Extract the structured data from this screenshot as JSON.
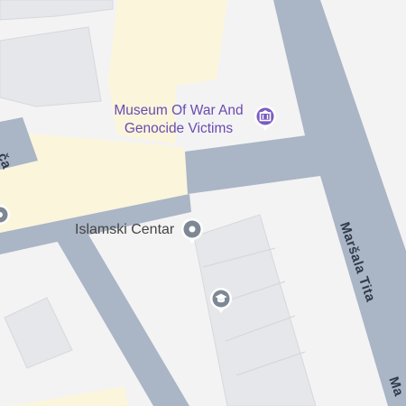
{
  "colors": {
    "land": "#f3f3f4",
    "building": "#e6e7ea",
    "building_outline": "#d6d8dc",
    "road": "#aab5c5",
    "pedestrian": "#fbf5dc",
    "museum_marker": "#7b5cc2",
    "generic_marker": "#7e8894",
    "museum_text": "#6a4bb0",
    "place_text": "#444444",
    "street_text": "#2f3a4a"
  },
  "pois": {
    "museum": {
      "name_line1": "Museum Of War And",
      "name_line2": "Genocide Victims",
      "icon": "museum-icon"
    },
    "islamski_centar": {
      "name": "Islamski Centar",
      "icon": "place-dot-icon"
    },
    "school": {
      "icon": "graduation-cap-icon"
    }
  },
  "streets": {
    "marsala_tita": "Maršala Tita",
    "marsala_tita_edge": "Ma",
    "left_street_fragment": "ča"
  }
}
